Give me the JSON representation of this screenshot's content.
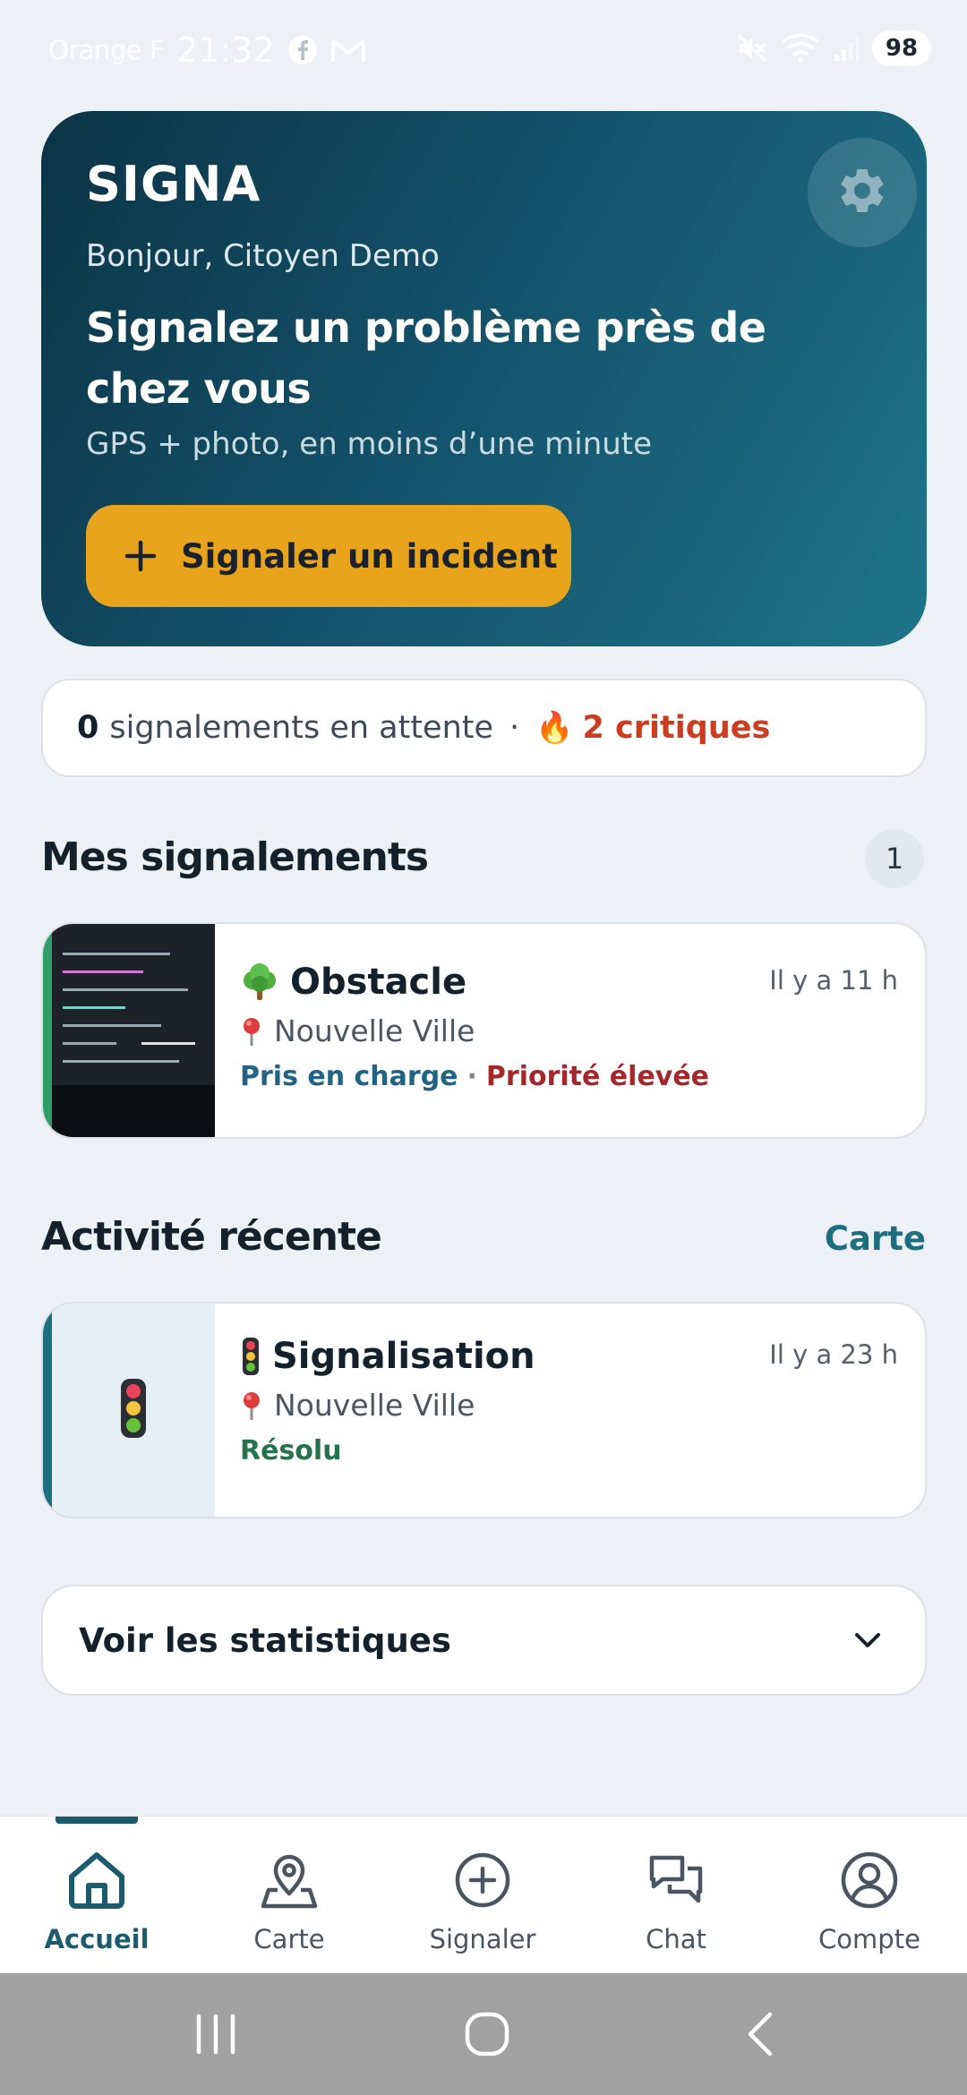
{
  "status_bar": {
    "carrier": "Orange F",
    "time": "21:32",
    "battery": "98",
    "icons": [
      "facebook-icon",
      "gmail-icon",
      "mute-icon",
      "wifi-icon",
      "signal-icon"
    ]
  },
  "hero": {
    "app_title": "SIGNA",
    "greeting": "Bonjour, Citoyen Demo",
    "headline": "Signalez un problème près de chez vous",
    "subline": "GPS + photo, en moins d’une minute",
    "report_button": "Signaler un incident",
    "settings_icon": "gear-icon"
  },
  "summary": {
    "pending_count": "0",
    "pending_text": "signalements en attente",
    "separator": "·",
    "critical_emoji": "🔥",
    "critical_text": "2 critiques"
  },
  "my_reports": {
    "title": "Mes signalements",
    "count": "1",
    "items": [
      {
        "emoji": "🌳",
        "title": "Obstacle",
        "time": "Il y a 11 h",
        "pin": "📍",
        "location": "Nouvelle Ville",
        "status": "Pris en charge",
        "separator": "·",
        "priority": "Priorité élevée",
        "accent_color": "#2f9d6a"
      }
    ]
  },
  "recent_activity": {
    "title": "Activité récente",
    "map_link": "Carte",
    "items": [
      {
        "emoji": "🚦",
        "title": "Signalisation",
        "time": "Il y a 23 h",
        "pin": "📍",
        "location": "Nouvelle Ville",
        "status": "Résolu",
        "accent_color": "#1d7080"
      }
    ]
  },
  "stats": {
    "label": "Voir les statistiques",
    "icon": "chevron-down-icon"
  },
  "bottom_nav": {
    "active_index": 0,
    "items": [
      {
        "label": "Accueil",
        "icon": "home-icon"
      },
      {
        "label": "Carte",
        "icon": "map-pin-icon"
      },
      {
        "label": "Signaler",
        "icon": "add-circle-icon"
      },
      {
        "label": "Chat",
        "icon": "chat-icon"
      },
      {
        "label": "Compte",
        "icon": "account-icon"
      }
    ]
  },
  "colors": {
    "hero_start": "#0c3346",
    "hero_end": "#1f7489",
    "cta": "#e8a51b",
    "primary": "#1b5b6e",
    "critical": "#cc3d1f",
    "priority": "#a4272b",
    "resolved": "#23734c"
  }
}
